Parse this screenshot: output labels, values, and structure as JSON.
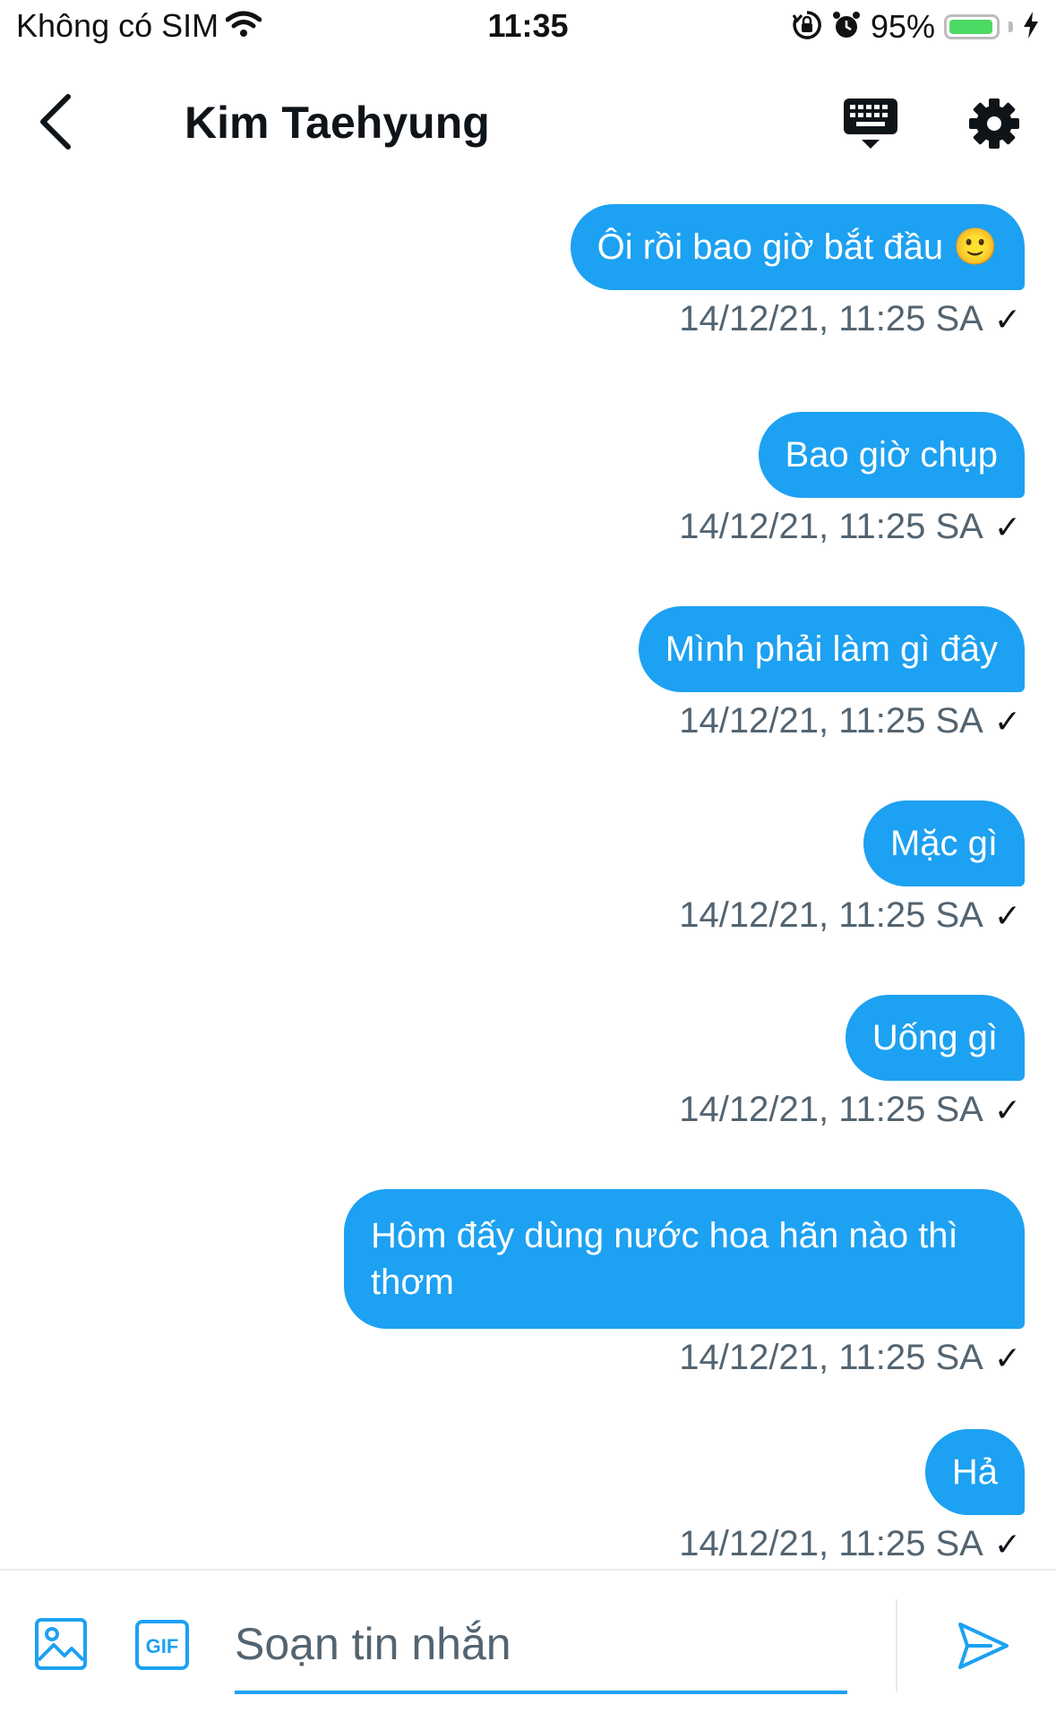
{
  "status_bar": {
    "carrier": "Không có SIM",
    "time": "11:35",
    "battery_percent": "95%",
    "battery_level": 0.95,
    "icons": [
      "wifi-icon",
      "orientation-lock-icon",
      "alarm-icon",
      "battery-icon",
      "charging-bolt-icon"
    ]
  },
  "header": {
    "title": "Kim Taehyung",
    "icons": [
      "back-arrow-icon",
      "keyboard-icon",
      "gear-icon"
    ]
  },
  "messages": [
    {
      "text": "Ôi rồi bao giờ bắt đầu 🙂",
      "timestamp": "14/12/21, 11:25 SA",
      "status": "✓"
    },
    {
      "text": "Bao giờ chụp",
      "timestamp": "14/12/21, 11:25 SA",
      "status": "✓"
    },
    {
      "text": "Mình phải làm gì đây",
      "timestamp": "14/12/21, 11:25 SA",
      "status": "✓"
    },
    {
      "text": "Mặc gì",
      "timestamp": "14/12/21, 11:25 SA",
      "status": "✓"
    },
    {
      "text": "Uống gì",
      "timestamp": "14/12/21, 11:25 SA",
      "status": "✓"
    },
    {
      "text": "Hôm đấy dùng nước hoa hãn nào thì thơm",
      "timestamp": "14/12/21, 11:25 SA",
      "status": "✓"
    },
    {
      "text": "Hả",
      "timestamp": "14/12/21, 11:25 SA",
      "status": "✓"
    }
  ],
  "composer": {
    "placeholder": "Soạn tin nhắn",
    "value": "",
    "gif_label": "GIF",
    "icons": [
      "image-icon",
      "gif-icon",
      "send-icon"
    ]
  },
  "colors": {
    "accent": "#1da1f2",
    "meta_text": "#536471",
    "battery_green": "#4cd964"
  }
}
